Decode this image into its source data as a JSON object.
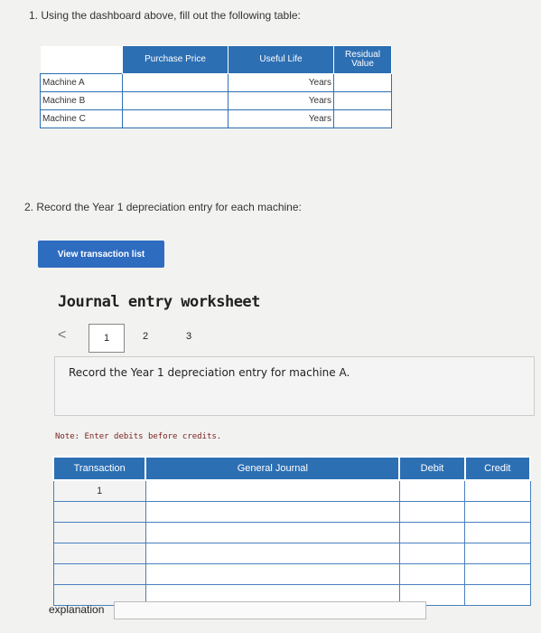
{
  "question1": "1. Using the dashboard above, fill out the following table:",
  "table1": {
    "headers": [
      "Purchase Price",
      "Useful Life",
      "Residual Value"
    ],
    "rows": [
      {
        "label": "Machine A",
        "unit": "Years"
      },
      {
        "label": "Machine B",
        "unit": "Years"
      },
      {
        "label": "Machine C",
        "unit": "Years"
      }
    ]
  },
  "question2": "2. Record the Year 1 depreciation entry for each machine:",
  "view_button": "View transaction list",
  "worksheet": {
    "title": "Journal entry worksheet",
    "prev": "<",
    "pages": [
      "1",
      "2",
      "3"
    ],
    "prompt": "Record the Year 1 depreciation entry for machine A.",
    "note": "Note: Enter debits before credits."
  },
  "journal_table": {
    "headers": [
      "Transaction",
      "General Journal",
      "Debit",
      "Credit"
    ],
    "rows": [
      {
        "transaction": "1"
      },
      {
        "transaction": ""
      },
      {
        "transaction": ""
      },
      {
        "transaction": ""
      },
      {
        "transaction": ""
      },
      {
        "transaction": ""
      }
    ]
  },
  "explanation_label": "explanation"
}
